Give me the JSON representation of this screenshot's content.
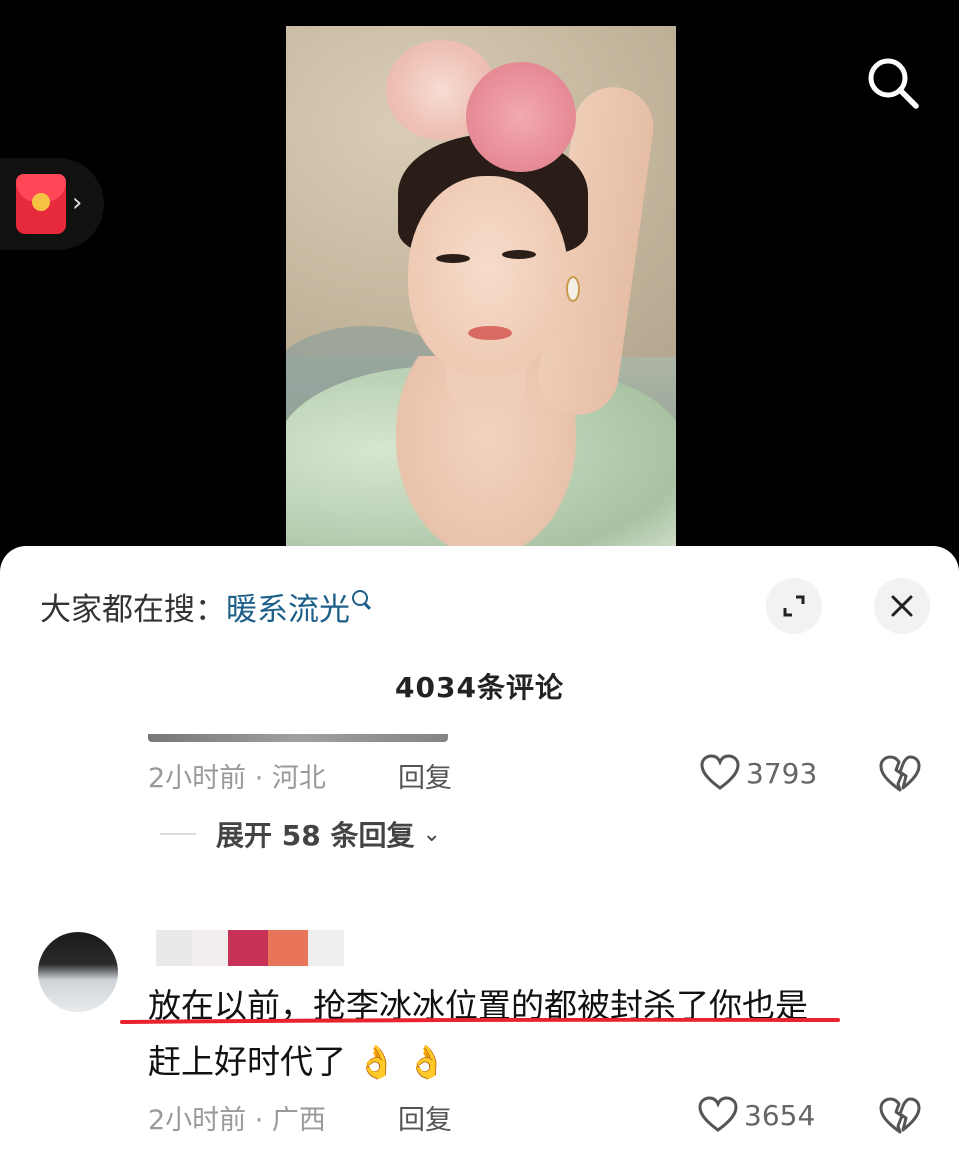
{
  "hot_search": {
    "prefix": "大家都在搜：",
    "keyword": "暖系流光"
  },
  "comments_title": "4034条评论",
  "comment1": {
    "time_location": "2小时前 · 河北",
    "reply_label": "回复",
    "likes": "3793"
  },
  "expand_replies": {
    "label": "展开 58 条回复"
  },
  "comment2": {
    "text_line1": "放在以前，抢李冰冰位置的都被封杀了你也是",
    "text_line2": "赶上好时代了",
    "emojis": [
      "👌",
      "👌"
    ],
    "time_location": "2小时前 · 广西",
    "reply_label": "回复",
    "likes": "3654"
  },
  "icons": {
    "search": "search-icon",
    "red_packet": "red-envelope-icon",
    "expand": "expand-icon",
    "close": "close-icon",
    "heart": "heart-icon",
    "broken_heart": "broken-heart-icon"
  },
  "colors": {
    "keyword": "#1e5f8a",
    "underline": "#e8232b",
    "red_packet": "#e62a3c"
  }
}
